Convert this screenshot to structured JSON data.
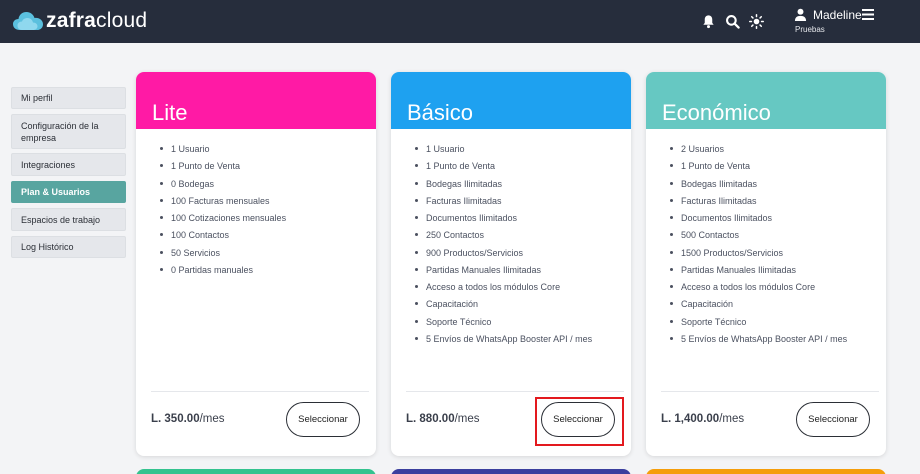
{
  "header": {
    "logo_part1": "zafra",
    "logo_part2": "cloud",
    "user_name": "Madeline",
    "user_org": "Pruebas",
    "icons": [
      "bell-icon",
      "search-icon",
      "sun-icon",
      "user-icon",
      "hamburger-menu-icon"
    ]
  },
  "sidebar": {
    "items": [
      {
        "label": "Mi perfil"
      },
      {
        "label": "Configuración de la empresa"
      },
      {
        "label": "Integraciones"
      },
      {
        "label": "Plan & Usuarios"
      },
      {
        "label": "Espacios de trabajo"
      },
      {
        "label": "Log Histórico"
      }
    ],
    "active_index": 3
  },
  "plans": [
    {
      "name": "Lite",
      "color": "#ff1aa5",
      "features": [
        "1 Usuario",
        "1 Punto de Venta",
        "0 Bodegas",
        "100 Facturas mensuales",
        "100 Cotizaciones mensuales",
        "100 Contactos",
        "50 Servicios",
        "0 Partidas manuales"
      ],
      "price": "L. 350.00",
      "period": "/mes",
      "button": "Seleccionar"
    },
    {
      "name": "Básico",
      "color": "#1ea1f0",
      "features": [
        "1 Usuario",
        "1 Punto de Venta",
        "Bodegas Ilimitadas",
        "Facturas Ilimitadas",
        "Documentos Ilimitados",
        "250 Contactos",
        "900 Productos/Servicios",
        "Partidas Manuales Ilimitadas",
        "Acceso a todos los módulos Core",
        "Capacitación",
        "Soporte Técnico",
        "5 Envíos de WhatsApp Booster API / mes"
      ],
      "price": "L. 880.00",
      "period": "/mes",
      "button": "Seleccionar"
    },
    {
      "name": "Económico",
      "color": "#66c8c2",
      "features": [
        "2 Usuarios",
        "1 Punto de Venta",
        "Bodegas Ilimitadas",
        "Facturas Ilimitadas",
        "Documentos Ilimitados",
        "500 Contactos",
        "1500 Productos/Servicios",
        "Partidas Manuales Ilimitadas",
        "Acceso a todos los módulos Core",
        "Capacitación",
        "Soporte Técnico",
        "5 Envíos de WhatsApp Booster API / mes"
      ],
      "price": "L. 1,400.00",
      "period": "/mes",
      "button": "Seleccionar"
    }
  ],
  "colors": {
    "topbar": "#262d3c",
    "sidebar_active": "#58a5a0",
    "highlight": "#e3191e",
    "peek_colors": [
      "#34c38f",
      "#3b3f9e",
      "#f59e0b"
    ]
  }
}
